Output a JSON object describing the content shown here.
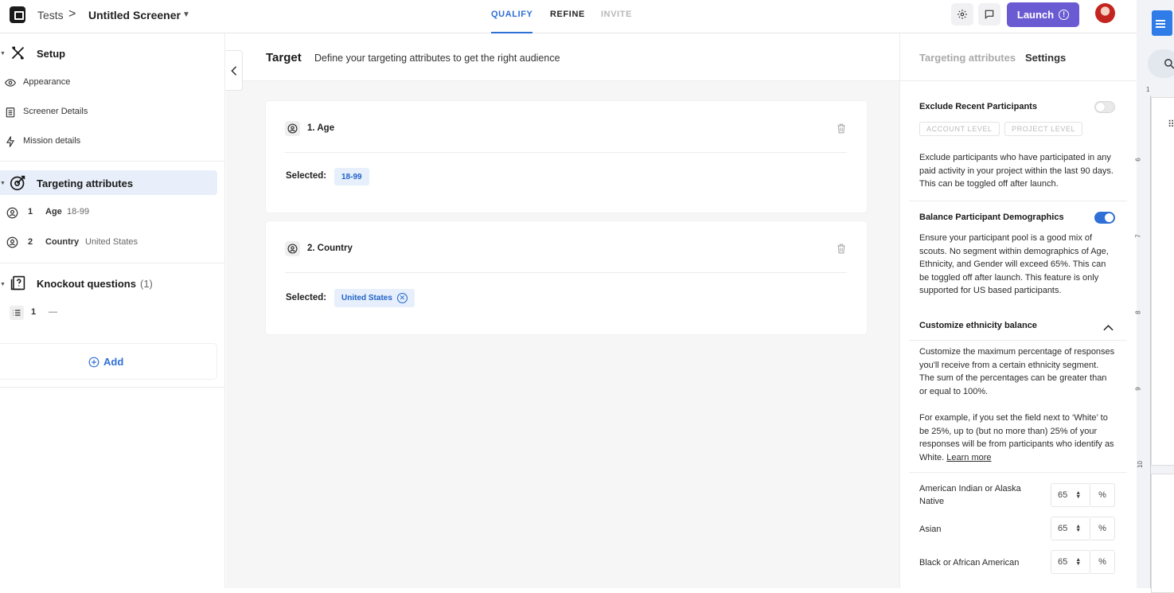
{
  "header": {
    "breadcrumb_root": "Tests",
    "breadcrumb_separator": ">",
    "screener_title": "Untitled Screener",
    "steps": {
      "qualify": "QUALIFY",
      "refine": "REFINE",
      "invite": "INVITE"
    },
    "launch_label": "Launch",
    "launch_info_glyph": "!"
  },
  "sidebar": {
    "setup": {
      "label": "Setup",
      "items": [
        {
          "label": "Appearance",
          "icon": "eye-icon"
        },
        {
          "label": "Screener Details",
          "icon": "clipboard-icon"
        },
        {
          "label": "Mission details",
          "icon": "bolt-icon"
        }
      ]
    },
    "targeting": {
      "label": "Targeting attributes",
      "items": [
        {
          "index": "1",
          "name": "Age",
          "value": "18-99"
        },
        {
          "index": "2",
          "name": "Country",
          "value": "United States"
        }
      ]
    },
    "knockout": {
      "label": "Knockout questions",
      "count": "(1)",
      "items": [
        {
          "index": "1",
          "value": "—"
        }
      ]
    },
    "add_label": "Add"
  },
  "main": {
    "title": "Target",
    "description": "Define your targeting attributes to get the right audience",
    "cards": [
      {
        "title": "1. Age",
        "selected_label": "Selected:",
        "chip": "18-99"
      },
      {
        "title": "2. Country",
        "selected_label": "Selected:",
        "chip": "United States"
      }
    ]
  },
  "right_panel": {
    "tabs": {
      "targeting": "Targeting attributes",
      "settings": "Settings"
    },
    "exclude": {
      "title": "Exclude Recent Participants",
      "enabled": false,
      "levels": [
        "ACCOUNT LEVEL",
        "PROJECT LEVEL"
      ],
      "description": "Exclude participants who have participated in any paid activity in your project within the last 90 days. This can be toggled off after launch."
    },
    "balance": {
      "title": "Balance Participant Demographics",
      "enabled": true,
      "description": "Ensure your participant pool is a good mix of scouts. No segment within demographics of Age, Ethnicity, and Gender will exceed 65%. This can be toggled off after launch. This feature is only supported for US based participants."
    },
    "ethnicity": {
      "title": "Customize ethnicity balance",
      "description": "Customize the maximum percentage of responses you'll receive from a certain ethnicity segment. The sum of the percentages can be greater than or equal to 100%.",
      "example": "For example, if you set the field next to ‘White’ to be 25%, up to (but no more than) 25% of your responses will be from participants who identify as White.",
      "learn_more": "Learn more",
      "unit": "%",
      "rows": [
        {
          "label": "American Indian or Alaska Native",
          "value": "65"
        },
        {
          "label": "Asian",
          "value": "65"
        },
        {
          "label": "Black or African American",
          "value": "65"
        }
      ]
    }
  },
  "doc_ruler": [
    "1",
    "6",
    "7",
    "8",
    "9",
    "10"
  ],
  "colors": {
    "accent": "#2f6fd6",
    "launch": "#6b5bd2",
    "chip_bg": "#e6effb",
    "selected_row": "#e8effa"
  }
}
